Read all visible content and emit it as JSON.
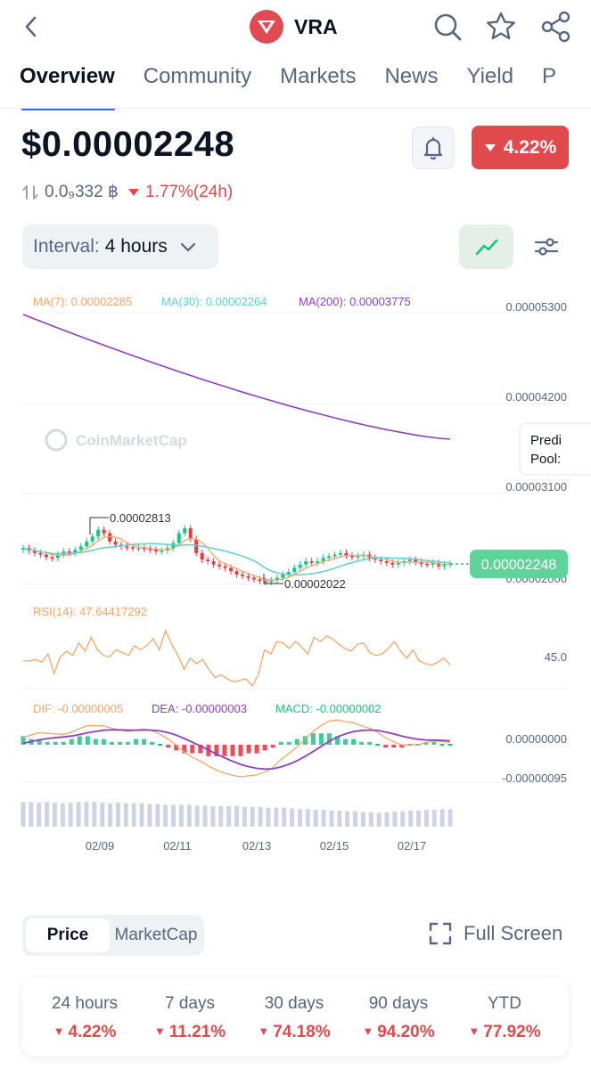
{
  "header": {
    "title": "VRA",
    "back_icon": "chevron-left-icon",
    "icons": [
      "search-icon",
      "star-icon",
      "share-icon"
    ]
  },
  "tabs": [
    {
      "label": "Overview",
      "active": true
    },
    {
      "label": "Community"
    },
    {
      "label": "Markets"
    },
    {
      "label": "News"
    },
    {
      "label": "Yield"
    },
    {
      "label": "P"
    }
  ],
  "price": {
    "value": "$0.00002248",
    "change_24h_badge": "4.22%",
    "btc_icon": "swap-vertical-icon",
    "btc_price": "0.0₉332 ฿",
    "btc_change": "1.77%(24h)",
    "negative_color": "#e04a4d"
  },
  "toolbar": {
    "interval_label": "Interval:",
    "interval_value": "4 hours"
  },
  "chart_data": {
    "type": "candlestick",
    "x_ticks": [
      "02/09",
      "02/11",
      "02/13",
      "02/15",
      "02/17"
    ],
    "price_axis": [
      "0.00005300",
      "0.00004200",
      "0.00003100",
      "0.00002000"
    ],
    "ma": {
      "ma7_label": "MA(7): 0.00002285",
      "ma30_label": "MA(30): 0.00002264",
      "ma200_label": "MA(200): 0.00003775",
      "colors": {
        "ma7": "#f3a66b",
        "ma30": "#5fcfd2",
        "ma200": "#8e3fbd"
      }
    },
    "high_label": "0.00002813",
    "low_label": "0.00002022",
    "current_price_tag": "0.00002248",
    "watermark": "CoinMarketCap",
    "side_tag_lines": [
      "Predi",
      "Pool:"
    ],
    "rsi": {
      "label": "RSI(14): 47.64417292",
      "axis": "45.0"
    },
    "macd": {
      "dif_label": "DIF: -0.00000005",
      "dea_label": "DEA: -0.00000003",
      "macd_label": "MACD: -0.00000002",
      "axis": [
        "0.00000000",
        "-0.00000095"
      ]
    },
    "closes": [
      2.44,
      2.41,
      2.38,
      2.36,
      2.33,
      2.32,
      2.36,
      2.4,
      2.38,
      2.42,
      2.46,
      2.52,
      2.58,
      2.66,
      2.62,
      2.52,
      2.48,
      2.46,
      2.45,
      2.44,
      2.44,
      2.43,
      2.42,
      2.4,
      2.41,
      2.44,
      2.5,
      2.62,
      2.68,
      2.55,
      2.38,
      2.3,
      2.28,
      2.24,
      2.22,
      2.2,
      2.16,
      2.12,
      2.1,
      2.08,
      2.06,
      2.04,
      2.03,
      2.05,
      2.08,
      2.12,
      2.15,
      2.2,
      2.24,
      2.28,
      2.26,
      2.28,
      2.32,
      2.34,
      2.36,
      2.38,
      2.35,
      2.33,
      2.34,
      2.36,
      2.32,
      2.3,
      2.28,
      2.26,
      2.24,
      2.26,
      2.28,
      2.3,
      2.27,
      2.25,
      2.24,
      2.26,
      2.22,
      2.24,
      2.25
    ],
    "rsi_values": [
      50,
      50,
      51,
      49,
      55,
      41,
      53,
      57,
      54,
      63,
      57,
      67,
      58,
      54,
      53,
      58,
      56,
      54,
      61,
      58,
      61,
      66,
      58,
      72,
      62,
      54,
      44,
      52,
      48,
      51,
      44,
      38,
      40,
      37,
      35,
      36,
      37,
      32,
      40,
      58,
      55,
      64,
      63,
      59,
      64,
      60,
      55,
      67,
      64,
      68,
      66,
      62,
      59,
      57,
      62,
      63,
      56,
      54,
      55,
      59,
      64,
      57,
      52,
      58,
      50,
      48,
      47,
      49,
      52,
      47
    ],
    "macd_hist": [
      3,
      2,
      2,
      1,
      1,
      1,
      2,
      3,
      3,
      2,
      2,
      1,
      1,
      1,
      2,
      2,
      1,
      0,
      -1,
      -2,
      -3,
      -3,
      -3,
      -4,
      -4,
      -4,
      -4,
      -4,
      -3,
      -3,
      -2,
      -1,
      1,
      1,
      2,
      3,
      4,
      4,
      4,
      3,
      2,
      2,
      1,
      1,
      0,
      -1,
      -1,
      -1,
      0,
      0,
      1,
      1,
      0,
      0
    ],
    "volume": [
      34,
      34,
      33,
      34,
      33,
      32,
      33,
      34,
      34,
      34,
      33,
      32,
      33,
      32,
      32,
      32,
      31,
      31,
      30,
      30,
      30,
      30,
      29,
      29,
      28,
      28,
      28,
      28,
      27,
      27,
      27,
      26,
      26,
      26,
      25,
      24,
      24,
      23,
      23,
      22,
      22,
      21,
      21,
      20,
      20,
      19,
      20,
      21,
      21,
      22,
      22,
      23,
      23,
      24,
      24
    ]
  },
  "period_toggle": {
    "active": "Price",
    "inactive": "MarketCap"
  },
  "fullscreen_label": "Full Screen",
  "performance": [
    {
      "label": "24 hours",
      "value": "4.22%"
    },
    {
      "label": "7 days",
      "value": "11.21%"
    },
    {
      "label": "30 days",
      "value": "74.18%"
    },
    {
      "label": "90 days",
      "value": "94.20%"
    },
    {
      "label": "YTD",
      "value": "77.92%"
    }
  ]
}
